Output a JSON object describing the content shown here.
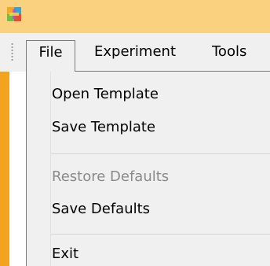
{
  "menubar": {
    "items": [
      {
        "label": "File"
      },
      {
        "label": "Experiment"
      },
      {
        "label": "Tools"
      }
    ]
  },
  "file_menu": {
    "items": [
      {
        "label": "Open Template",
        "enabled": true
      },
      {
        "label": "Save Template",
        "enabled": true
      },
      {
        "label": "Restore Defaults",
        "enabled": false
      },
      {
        "label": "Save Defaults",
        "enabled": true
      },
      {
        "label": "Exit",
        "enabled": true
      }
    ]
  },
  "colors": {
    "titlebar": "#f9d17f",
    "accent_strip": "#f2a41e",
    "menu_bg": "#f0f0f0",
    "disabled_text": "#8a8a8a"
  }
}
